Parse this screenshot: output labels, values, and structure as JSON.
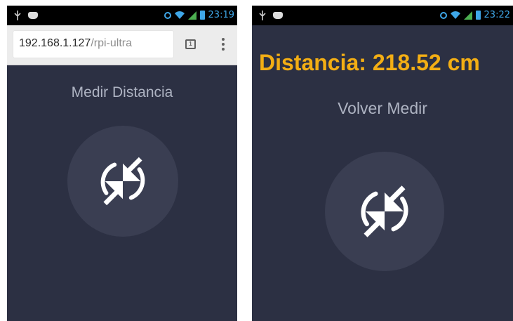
{
  "left_screen": {
    "status_bar": {
      "time": "23:19"
    },
    "browser": {
      "url_host": "192.168.1.127",
      "url_path": "/rpi-ultra",
      "tab_count": "1"
    },
    "button_label": "Medir Distancia"
  },
  "right_screen": {
    "status_bar": {
      "time": "23:22"
    },
    "distance_text": "Distancia: 218.52 cm",
    "button_label": "Volver Medir"
  },
  "colors": {
    "background": "#2c3043",
    "button_circle": "#3a3e52",
    "label": "#aeb3c2",
    "distance": "#f3ae14",
    "status_accent": "#3fa7e8"
  },
  "icons": {
    "measure": "sync-arrows-icon",
    "status_left": [
      "usb-icon",
      "bbm-icon"
    ],
    "status_right": [
      "alarm-icon",
      "wifi-icon",
      "signal-icon",
      "battery-icon"
    ],
    "browser": [
      "tabs-icon",
      "overflow-menu-icon"
    ]
  }
}
